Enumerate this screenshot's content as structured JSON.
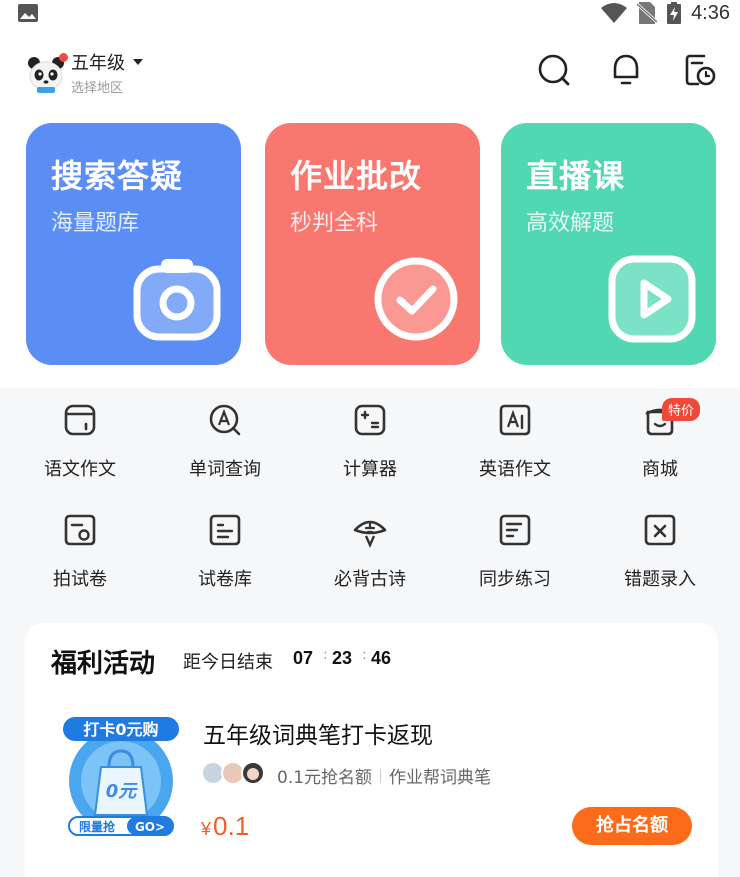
{
  "status_bar": {
    "time": "4:36",
    "icons": [
      "gallery-icon",
      "wifi-icon",
      "no-sim-icon",
      "battery-charging-icon"
    ]
  },
  "header": {
    "grade": "五年级",
    "region": "选择地区",
    "icons": [
      "search-icon",
      "notification-bell-icon",
      "history-icon"
    ]
  },
  "feature_cards": [
    {
      "title": "搜索答疑",
      "subtitle": "海量题库",
      "icon": "camera-icon",
      "color": "#5a8ef5"
    },
    {
      "title": "作业批改",
      "subtitle": "秒判全科",
      "icon": "check-icon",
      "color": "#f8776f"
    },
    {
      "title": "直播课",
      "subtitle": "高效解题",
      "icon": "play-icon",
      "color": "#51d8b2"
    }
  ],
  "tools": [
    {
      "label": "语文作文",
      "icon": "essay-icon"
    },
    {
      "label": "单词查询",
      "icon": "word-lookup-icon"
    },
    {
      "label": "计算器",
      "icon": "calculator-icon"
    },
    {
      "label": "英语作文",
      "icon": "english-essay-icon"
    },
    {
      "label": "商城",
      "icon": "mall-icon",
      "badge": "特价"
    },
    {
      "label": "拍试卷",
      "icon": "scan-paper-icon"
    },
    {
      "label": "试卷库",
      "icon": "paper-library-icon"
    },
    {
      "label": "必背古诗",
      "icon": "poem-icon"
    },
    {
      "label": "同步练习",
      "icon": "practice-icon"
    },
    {
      "label": "错题录入",
      "icon": "wrong-question-icon"
    }
  ],
  "welfare": {
    "title": "福利活动",
    "countdown_label": "距今日结束",
    "countdown": {
      "hours": "07",
      "minutes": "23",
      "seconds": "46"
    },
    "product": {
      "image_text_top": "打卡0元购",
      "image_text_price": "0元",
      "image_text_bottom": "限量抢",
      "image_text_go": "GO>",
      "title": "五年级词典笔打卡返现",
      "meta_left": "0.1元抢名额",
      "meta_right": "作业帮词典笔",
      "price_symbol": "¥",
      "price": "0.1",
      "cta": "抢占名额"
    }
  },
  "colors": {
    "accent_orange": "#fb6b1a",
    "price_red": "#f35d2a",
    "badge_red": "#f0493a",
    "tools_bg": "#f6f7f9"
  }
}
